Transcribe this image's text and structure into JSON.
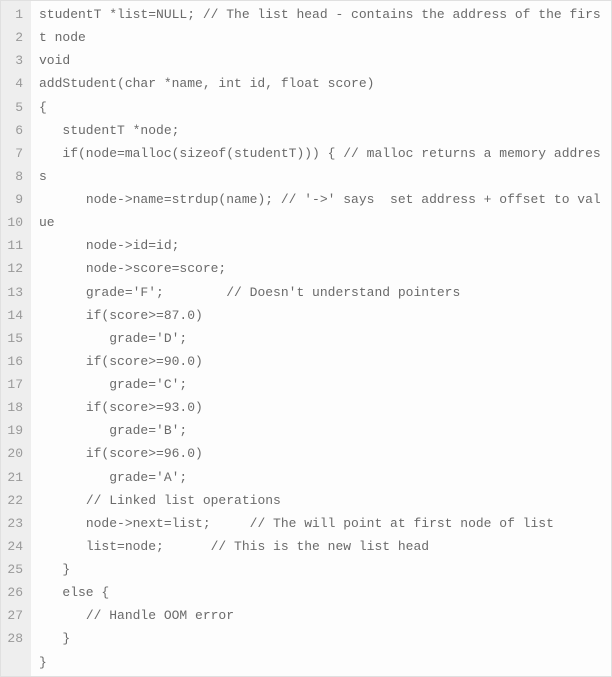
{
  "editor": {
    "lines": [
      {
        "num": "1",
        "indent": 0,
        "text": "studentT *list=NULL; // The list head - contains the address of the first node"
      },
      {
        "num": "2",
        "indent": 0,
        "text": ""
      },
      {
        "num": "3",
        "indent": 0,
        "text": "void"
      },
      {
        "num": "4",
        "indent": 0,
        "text": "addStudent(char *name, int id, float score)"
      },
      {
        "num": "5",
        "indent": 0,
        "text": "{"
      },
      {
        "num": "6",
        "indent": 1,
        "text": "studentT *node;"
      },
      {
        "num": "7",
        "indent": 0,
        "text": ""
      },
      {
        "num": "8",
        "indent": 1,
        "text": "if(node=malloc(sizeof(studentT))) { // malloc returns a memory address"
      },
      {
        "num": "9",
        "indent": 2,
        "text": "node->name=strdup(name); // '->' says  set address + offset to value"
      },
      {
        "num": "10",
        "indent": 2,
        "text": "node->id=id;"
      },
      {
        "num": "11",
        "indent": 2,
        "text": "node->score=score;"
      },
      {
        "num": "12",
        "indent": 2,
        "text": "grade='F';        // Doesn't understand pointers"
      },
      {
        "num": "13",
        "indent": 2,
        "text": "if(score>=87.0)"
      },
      {
        "num": "14",
        "indent": 3,
        "text": "grade='D';"
      },
      {
        "num": "15",
        "indent": 2,
        "text": "if(score>=90.0)"
      },
      {
        "num": "16",
        "indent": 3,
        "text": "grade='C';"
      },
      {
        "num": "17",
        "indent": 2,
        "text": "if(score>=93.0)"
      },
      {
        "num": "18",
        "indent": 3,
        "text": "grade='B';"
      },
      {
        "num": "19",
        "indent": 2,
        "text": "if(score>=96.0)"
      },
      {
        "num": "20",
        "indent": 3,
        "text": "grade='A';"
      },
      {
        "num": "21",
        "indent": 2,
        "text": "// Linked list operations"
      },
      {
        "num": "22",
        "indent": 2,
        "text": "node->next=list;     // The will point at first node of list"
      },
      {
        "num": "23",
        "indent": 2,
        "text": "list=node;      // This is the new list head"
      },
      {
        "num": "24",
        "indent": 1,
        "text": "}"
      },
      {
        "num": "25",
        "indent": 1,
        "text": "else {"
      },
      {
        "num": "26",
        "indent": 2,
        "text": "// Handle OOM error"
      },
      {
        "num": "27",
        "indent": 1,
        "text": "}"
      },
      {
        "num": "28",
        "indent": 0,
        "text": "}"
      }
    ]
  }
}
